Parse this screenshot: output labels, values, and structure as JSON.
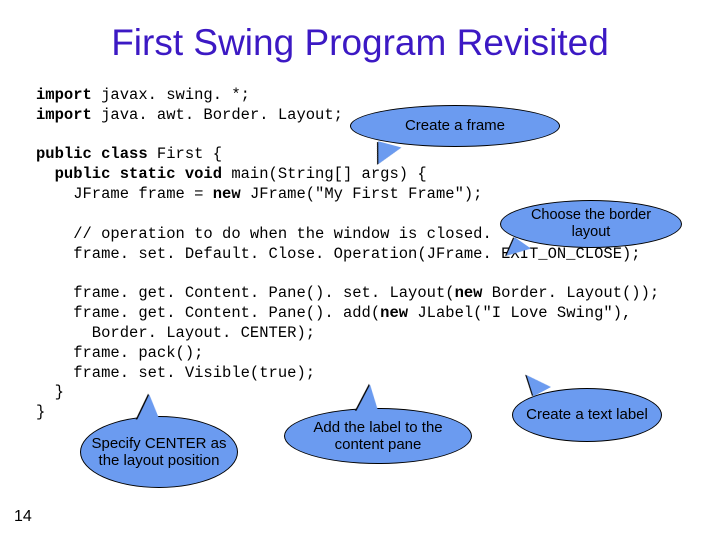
{
  "title": "First Swing Program Revisited",
  "code": {
    "l1a": "import",
    "l1b": " javax. swing. *;",
    "l2a": "import",
    "l2b": " java. awt. Border. Layout;",
    "l3a": "public class",
    "l3b": " First {",
    "l4a": "  public static void",
    "l4b": " main(String[] args) {",
    "l5a": "    JFrame frame = ",
    "l5b": "new",
    "l5c": " JFrame(\"My First Frame\");",
    "l6": "    // operation to do when the window is closed.",
    "l7": "    frame. set. Default. Close. Operation(JFrame. EXIT_ON_CLOSE);",
    "l8a": "    frame. get. Content. Pane(). set. Layout(",
    "l8b": "new",
    "l8c": " Border. Layout());",
    "l9a": "    frame. get. Content. Pane(). add(",
    "l9b": "new",
    "l9c": " JLabel(\"I Love Swing\"),",
    "l10": "      Border. Layout. CENTER);",
    "l11": "    frame. pack();",
    "l12": "    frame. set. Visible(true);",
    "l13": "  }",
    "l14": "}"
  },
  "callouts": {
    "c1": "Create a frame",
    "c2": "Choose the border layout",
    "c3": "Specify CENTER as  the layout position",
    "c4": "Add the label to the content pane",
    "c5": "Create a text label"
  },
  "pagenum": "14"
}
